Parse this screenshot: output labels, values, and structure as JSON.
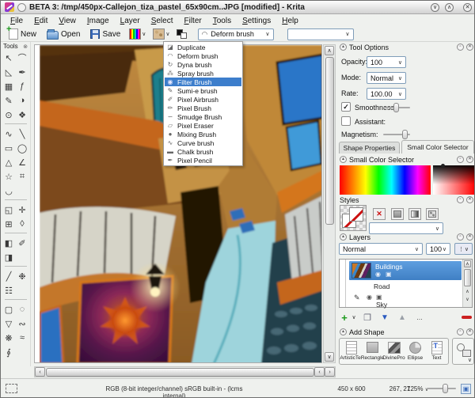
{
  "window": {
    "title": "BETA 3: /tmp/450px-Callejon_tiza_pastel_65x90cm..JPG [modified] - Krita"
  },
  "menu": {
    "items": [
      "File",
      "Edit",
      "View",
      "Image",
      "Layer",
      "Select",
      "Filter",
      "Tools",
      "Settings",
      "Help"
    ]
  },
  "toolbar": {
    "new_label": "New",
    "open_label": "Open",
    "save_label": "Save",
    "brush_combo_value": "Deform brush"
  },
  "brush_menu": {
    "items": [
      {
        "label": "Duplicate",
        "icon": "duplicate-icon",
        "glyph": "◪"
      },
      {
        "label": "Deform brush",
        "icon": "deform-brush-icon",
        "glyph": "◠"
      },
      {
        "label": "Dyna brush",
        "icon": "dyna-brush-icon",
        "glyph": "↻"
      },
      {
        "label": "Spray brush",
        "icon": "spray-brush-icon",
        "glyph": "⁂"
      },
      {
        "label": "Filter Brush",
        "icon": "filter-brush-icon",
        "glyph": "◉",
        "selected": true
      },
      {
        "label": "Sumi-e brush",
        "icon": "sumi-brush-icon",
        "glyph": "✎"
      },
      {
        "label": "Pixel Airbrush",
        "icon": "airbrush-icon",
        "glyph": "✐"
      },
      {
        "label": "Pixel Brush",
        "icon": "pixel-brush-icon",
        "glyph": "✏"
      },
      {
        "label": "Smudge Brush",
        "icon": "smudge-brush-icon",
        "glyph": "∽"
      },
      {
        "label": "Pixel Eraser",
        "icon": "eraser-icon",
        "glyph": "▱"
      },
      {
        "label": "Mixing Brush",
        "icon": "mixing-brush-icon",
        "glyph": "●"
      },
      {
        "label": "Curve brush",
        "icon": "curve-brush-icon",
        "glyph": "∿"
      },
      {
        "label": "Chalk brush",
        "icon": "chalk-brush-icon",
        "glyph": "▬"
      },
      {
        "label": "Pixel Pencil",
        "icon": "pencil-icon",
        "glyph": "✒"
      }
    ]
  },
  "toolbox": {
    "title": "Tools",
    "tools": [
      {
        "name": "select",
        "glyph": "↖"
      },
      {
        "name": "edit-path",
        "glyph": "⌒"
      },
      {
        "name": "ruler",
        "glyph": "◺"
      },
      {
        "name": "calligraphy",
        "glyph": "✒"
      },
      {
        "name": "pattern-edit",
        "glyph": "▦"
      },
      {
        "name": "filter-effects",
        "glyph": "ƒ"
      },
      {
        "name": "paint-brush",
        "glyph": "✎"
      },
      {
        "name": "gradient",
        "glyph": "◑"
      },
      {
        "name": "color-picker",
        "glyph": "⊙"
      },
      {
        "name": "pan",
        "glyph": "❖"
      },
      {
        "divider": true
      },
      {
        "name": "freehand",
        "glyph": "∿"
      },
      {
        "name": "line",
        "glyph": "╲"
      },
      {
        "name": "rectangle",
        "glyph": "▭"
      },
      {
        "name": "ellipse",
        "glyph": "◯"
      },
      {
        "name": "polygon",
        "glyph": "△"
      },
      {
        "name": "polyline",
        "glyph": "∠"
      },
      {
        "name": "star",
        "glyph": "☆"
      },
      {
        "name": "crop",
        "glyph": "⌗"
      },
      {
        "name": "arc",
        "glyph": "◡"
      },
      {
        "blank": true
      },
      {
        "divider": true
      },
      {
        "name": "transform",
        "glyph": "◱"
      },
      {
        "name": "move",
        "glyph": "✛"
      },
      {
        "name": "grid",
        "glyph": "⊞"
      },
      {
        "name": "perspective",
        "glyph": "◊"
      },
      {
        "divider": true
      },
      {
        "name": "shapes-3d",
        "glyph": "◧"
      },
      {
        "name": "measure",
        "glyph": "✐"
      },
      {
        "name": "fill",
        "glyph": "◨"
      },
      {
        "blank": true
      },
      {
        "divider": true
      },
      {
        "name": "assistant",
        "glyph": "╱"
      },
      {
        "name": "multibrush",
        "glyph": "❉"
      },
      {
        "name": "grid-tool",
        "glyph": "☷"
      },
      {
        "blank": true
      },
      {
        "divider": true
      },
      {
        "name": "select-rectangular",
        "glyph": "▢"
      },
      {
        "name": "select-elliptical",
        "glyph": "◌"
      },
      {
        "name": "select-polygonal",
        "glyph": "▽"
      },
      {
        "name": "select-outline",
        "glyph": "∾"
      },
      {
        "name": "select-contiguous",
        "glyph": "❋"
      },
      {
        "name": "select-similar",
        "glyph": "≈"
      },
      {
        "name": "select-magnetic",
        "glyph": "∮"
      },
      {
        "blank": true
      }
    ]
  },
  "tool_options": {
    "title": "Tool Options",
    "opacity_label": "Opacity:",
    "opacity_value": "100",
    "mode_label": "Mode:",
    "mode_value": "Normal",
    "rate_label": "Rate:",
    "rate_value": "100.00",
    "smoothness_label": "Smoothness",
    "assistant_label": "Assistant:",
    "magnetism_label": "Magnetism:"
  },
  "tabs": {
    "shape_properties": "Shape Properties",
    "small_color_selector": "Small Color Selector"
  },
  "color_selector": {
    "title": "Small Color Selector"
  },
  "styles": {
    "title": "Styles"
  },
  "layers": {
    "title": "Layers",
    "blend_mode": "Normal",
    "opacity": "100",
    "more_label": "...",
    "rows": [
      {
        "name": "Buildings",
        "selected": true
      },
      {
        "name": "Road"
      },
      {
        "name": "Sky"
      }
    ]
  },
  "add_shape": {
    "title": "Add Shape",
    "shapes": [
      "ArtisticTe:",
      "Rectangle",
      "DivinePro",
      "Ellipse",
      "Text"
    ]
  },
  "statusbar": {
    "colorspace": "RGB (8-bit integer/channel)  sRGB built-in - (lcms internal)",
    "size": "450 x 600",
    "coords": "267, 27",
    "zoom": "125%"
  },
  "colors": {
    "selection_blue": "#3d7ecc",
    "layer_selected": "#4a90d9",
    "delete_red": "#cc2020",
    "add_green": "#1c9a1c"
  }
}
